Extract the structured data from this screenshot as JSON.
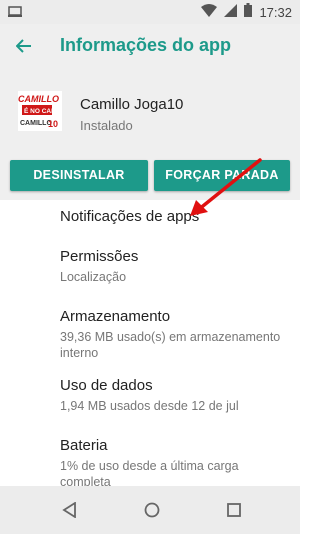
{
  "status_bar": {
    "time": "17:32",
    "icons": [
      "notification-icon",
      "wifi-icon",
      "signal-icon",
      "battery-icon"
    ]
  },
  "app_bar": {
    "title": "Informações do app",
    "back_icon": "back-arrow-icon"
  },
  "app": {
    "name": "Camillo Joga10",
    "status": "Instalado",
    "logo_text_top": "CAMILLO",
    "logo_text_mid": "É NO CANAL",
    "logo_text_bottom": "CAMILLO 10"
  },
  "actions": {
    "uninstall_label": "DESINSTALAR",
    "force_stop_label": "FORÇAR PARADA"
  },
  "settings": [
    {
      "label": "Notificações de apps",
      "sub": ""
    },
    {
      "label": "Permissões",
      "sub": "Localização"
    },
    {
      "label": "Armazenamento",
      "sub": "39,36 MB usado(s) em armazenamento interno"
    },
    {
      "label": "Uso de dados",
      "sub": "1,94 MB usados desde 12 de jul"
    },
    {
      "label": "Bateria",
      "sub": "1% de uso desde a última carga completa"
    }
  ],
  "colors": {
    "accent": "#1d9a8a",
    "annotation_arrow": "#e01010"
  },
  "nav": [
    "back-triangle-icon",
    "home-circle-icon",
    "recents-square-icon"
  ]
}
